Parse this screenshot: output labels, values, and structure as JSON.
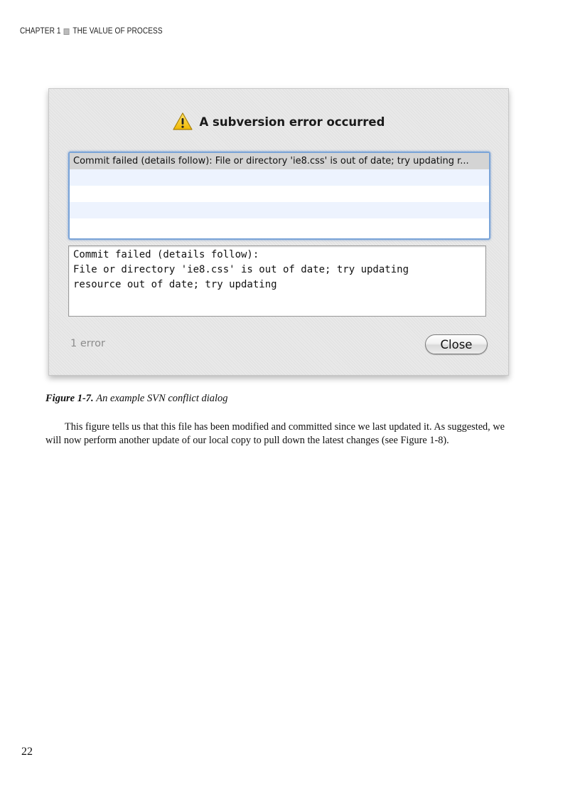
{
  "running_head": {
    "chapter": "CHAPTER 1",
    "title": "THE VALUE OF PROCESS"
  },
  "dialog": {
    "title": "A subversion error occurred",
    "title_icon": "warning-triangle-icon",
    "list_rows": [
      "Commit failed (details follow): File or directory 'ie8.css' is out of date; try updating r...",
      "",
      "",
      "",
      ""
    ],
    "details_lines": [
      "Commit failed (details follow):",
      "File or directory 'ie8.css' is out of date; try updating",
      "resource out of date; try updating"
    ],
    "error_count": "1 error",
    "close_label": "Close",
    "colors": {
      "warning_yellow": "#f3c21b",
      "focus_ring": "#7aa4d8",
      "selected_row": "#d4d4d4",
      "alt_row": "#edf3fe"
    }
  },
  "caption": {
    "number": "Figure 1-7.",
    "title": "An example SVN conflict dialog"
  },
  "body_paragraph": "This figure tells us that this file has been modified and committed since we last updated it. As suggested, we will now perform another update of our local copy to pull down the latest changes (see Figure 1-8).",
  "page_number": "22"
}
